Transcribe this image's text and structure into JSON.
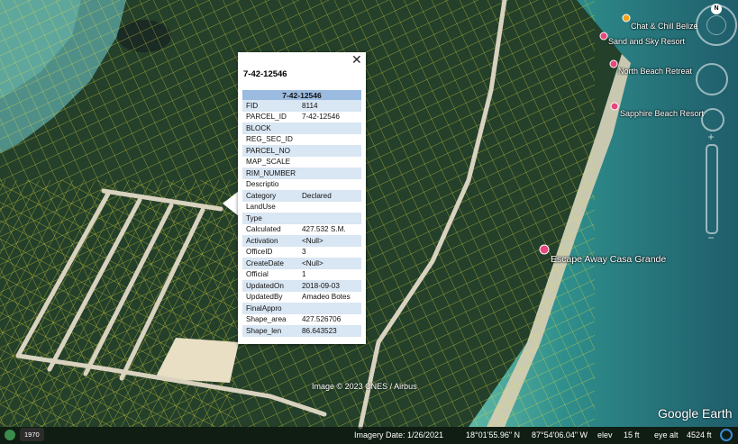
{
  "popup": {
    "title": "7-42-12546",
    "close_label": "✕",
    "table_header": "7-42-12546",
    "rows": [
      {
        "key": "FID",
        "value": "8114"
      },
      {
        "key": "PARCEL_ID",
        "value": "7-42-12546"
      },
      {
        "key": "BLOCK",
        "value": ""
      },
      {
        "key": "REG_SEC_ID",
        "value": ""
      },
      {
        "key": "PARCEL_NO",
        "value": ""
      },
      {
        "key": "MAP_SCALE",
        "value": ""
      },
      {
        "key": "RIM_NUMBER",
        "value": ""
      },
      {
        "key": "Descriptio",
        "value": ""
      },
      {
        "key": "Category",
        "value": "Declared"
      },
      {
        "key": "LandUse",
        "value": ""
      },
      {
        "key": "Type",
        "value": ""
      },
      {
        "key": "Calculated",
        "value": "427.532 S.M."
      },
      {
        "key": "Activation",
        "value": "<Null>"
      },
      {
        "key": "OfficeID",
        "value": "3"
      },
      {
        "key": "CreateDate",
        "value": "<Null>"
      },
      {
        "key": "Official",
        "value": "1"
      },
      {
        "key": "UpdatedOn",
        "value": "2018-09-03"
      },
      {
        "key": "UpdatedBy",
        "value": "Amadeo Botes"
      },
      {
        "key": "FinalAppro",
        "value": ""
      },
      {
        "key": "Shape_area",
        "value": "427.526706"
      },
      {
        "key": "Shape_len",
        "value": "86.643523"
      }
    ]
  },
  "places": {
    "chat_chill": "Chat & Chill Belize",
    "sand_sky": "Sand and Sky Resort",
    "north_beach": "North Beach Retreat",
    "sapphire": "Sapphire Beach Resort",
    "escape_away": "Escape Away Casa Grande"
  },
  "map": {
    "copyright": "Image © 2023 CNES / Airbus",
    "branding": "Google Earth",
    "compass_letter": "N",
    "zoom_in": "+",
    "zoom_out": "−"
  },
  "status": {
    "year": "1970",
    "imagery_date": "Imagery Date: 1/26/2021",
    "latitude": "18°01'55.96\" N",
    "longitude": "87°54'06.04\" W",
    "elev_label": "elev",
    "elev_value": "15 ft",
    "eye_alt_label": "eye alt",
    "eye_alt_value": "4524 ft"
  },
  "colors": {
    "parcel_lines": "#e8e23a",
    "popup_header": "#9bbbe0",
    "popup_row_alt": "#d9e6f3",
    "pin_pink": "#e8467c",
    "pin_orange": "#f0a020",
    "sea_shallow": "#3aa39a",
    "sea_deep": "#1f5d6b"
  }
}
